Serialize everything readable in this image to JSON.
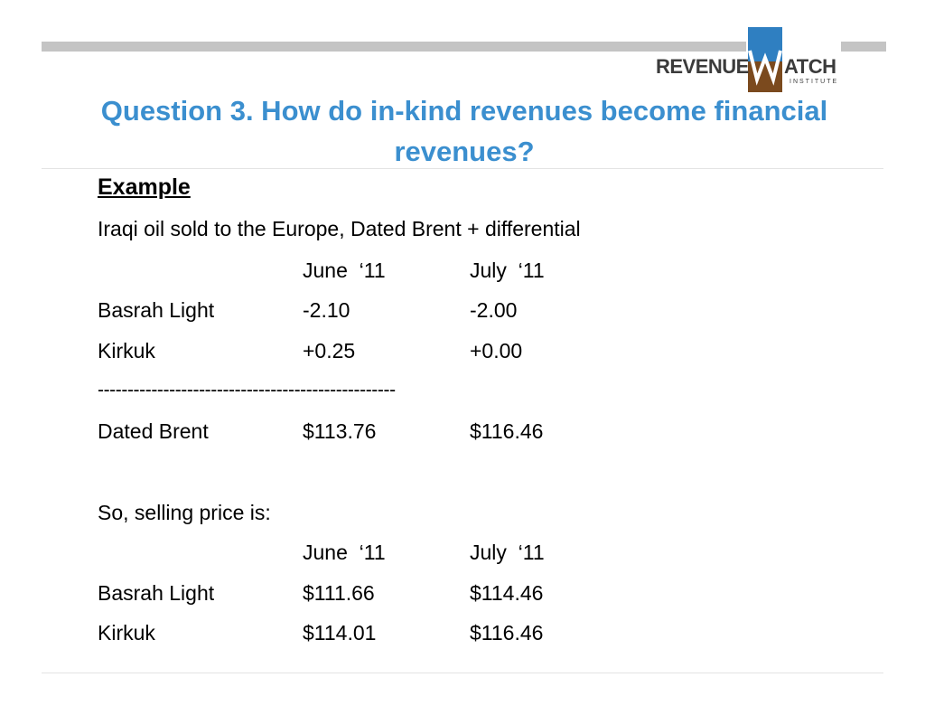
{
  "logo": {
    "text_left": "REVENUE",
    "text_w": "W",
    "text_right": "ATCH",
    "sub": "INSTITUTE"
  },
  "title": {
    "line1": "Question 3. How do in-kind revenues become financial",
    "line2": "revenues?"
  },
  "example": {
    "heading": "Example",
    "intro": "Iraqi oil sold to the Europe, Dated Brent + differential",
    "header": {
      "c1": "June  ‘11",
      "c2": "July  ‘11"
    },
    "rows": [
      {
        "label": "Basrah Light",
        "c1": "-2.10",
        "c2": "-2.00"
      },
      {
        "label": "Kirkuk",
        "c1": "+0.25",
        "c2": "+0.00"
      }
    ],
    "dashes": "--------------------------------------------------",
    "brent": {
      "label": "Dated Brent",
      "c1": "$113.76",
      "c2": "$116.46"
    },
    "selling_intro": "So, selling price is:",
    "header2": {
      "c1": "June  ‘11",
      "c2": "July  ‘11"
    },
    "rows2": [
      {
        "label": "Basrah Light",
        "c1": "$111.66",
        "c2": "$114.46"
      },
      {
        "label": "Kirkuk",
        "c1": "$114.01",
        "c2": "$116.46"
      }
    ]
  },
  "colors": {
    "title": "#3b8fcf",
    "logo_brown": "#7b4a1e",
    "logo_blue": "#2f7fc1",
    "bar_gray": "#c4c4c4"
  }
}
